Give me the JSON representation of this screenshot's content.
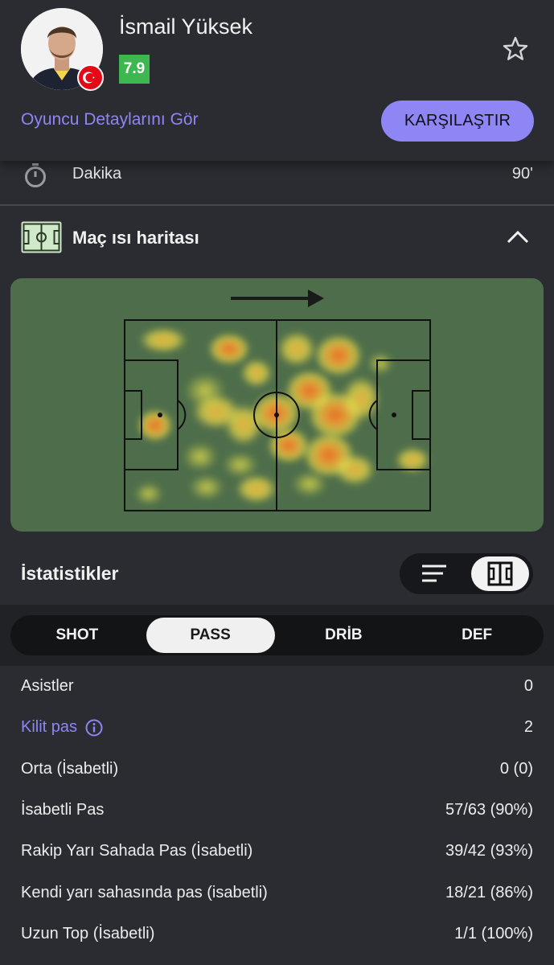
{
  "player": {
    "name": "İsmail Yüksek",
    "rating": "7.9",
    "details_link": "Oyuncu Detaylarını Gör",
    "compare_label": "KARŞILAŞTIR",
    "flag_icon": "turkey-flag-icon"
  },
  "minutes": {
    "label": "Dakika",
    "value": "90'"
  },
  "heatmap": {
    "title": "Maç ısı haritası",
    "direction_icon": "arrow-right-icon"
  },
  "stats": {
    "title": "İstatistikler",
    "tabs": [
      {
        "label": "SHOT",
        "active": false
      },
      {
        "label": "PASS",
        "active": true
      },
      {
        "label": "DRİB",
        "active": false
      },
      {
        "label": "DEF",
        "active": false
      }
    ],
    "rows": [
      {
        "label": "Asistler",
        "value": "0"
      },
      {
        "label": "Kilit pas",
        "value": "2",
        "info": true
      },
      {
        "label": "Orta (İsabetli)",
        "value": "0 (0)"
      },
      {
        "label": "İsabetli Pas",
        "value": "57/63 (90%)"
      },
      {
        "label": "Rakip Yarı Sahada Pas (İsabetli)",
        "value": "39/42 (93%)"
      },
      {
        "label": "Kendi yarı sahasında pas (isabetli)",
        "value": "18/21 (86%)"
      },
      {
        "label": "Uzun Top (İsabetli)",
        "value": "1/1 (100%)"
      }
    ]
  },
  "colors": {
    "accent": "#8e86f5",
    "rating_green": "#3fb750",
    "pitch_green": "#4e6e4b",
    "background": "#2a2c31"
  }
}
